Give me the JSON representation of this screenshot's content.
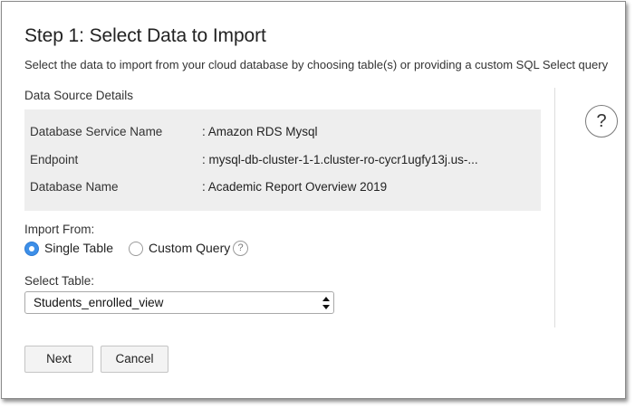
{
  "header": {
    "title": "Step 1: Select Data to Import",
    "subtitle": "Select the data to import from your cloud database by choosing table(s) or providing a custom SQL Select query"
  },
  "data_source": {
    "section_label": "Data Source Details",
    "rows": [
      {
        "label": "Database Service Name",
        "value": ": Amazon RDS Mysql"
      },
      {
        "label": "Endpoint",
        "value": ": mysql-db-cluster-1-1.cluster-ro-cycr1ugfy13j.us-..."
      },
      {
        "label": "Database Name",
        "value": ": Academic Report Overview 2019"
      }
    ]
  },
  "help": {
    "glyph": "?"
  },
  "import_from": {
    "label": "Import From:",
    "options": [
      {
        "label": "Single Table",
        "selected": true
      },
      {
        "label": "Custom Query",
        "selected": false
      }
    ],
    "help_glyph": "?"
  },
  "select_table": {
    "label": "Select Table:",
    "value": "Students_enrolled_view"
  },
  "buttons": {
    "next": "Next",
    "cancel": "Cancel"
  },
  "colors": {
    "accent": "#3d8fe8",
    "panel_bg": "#eeeeee",
    "border": "#8a8a8a"
  }
}
